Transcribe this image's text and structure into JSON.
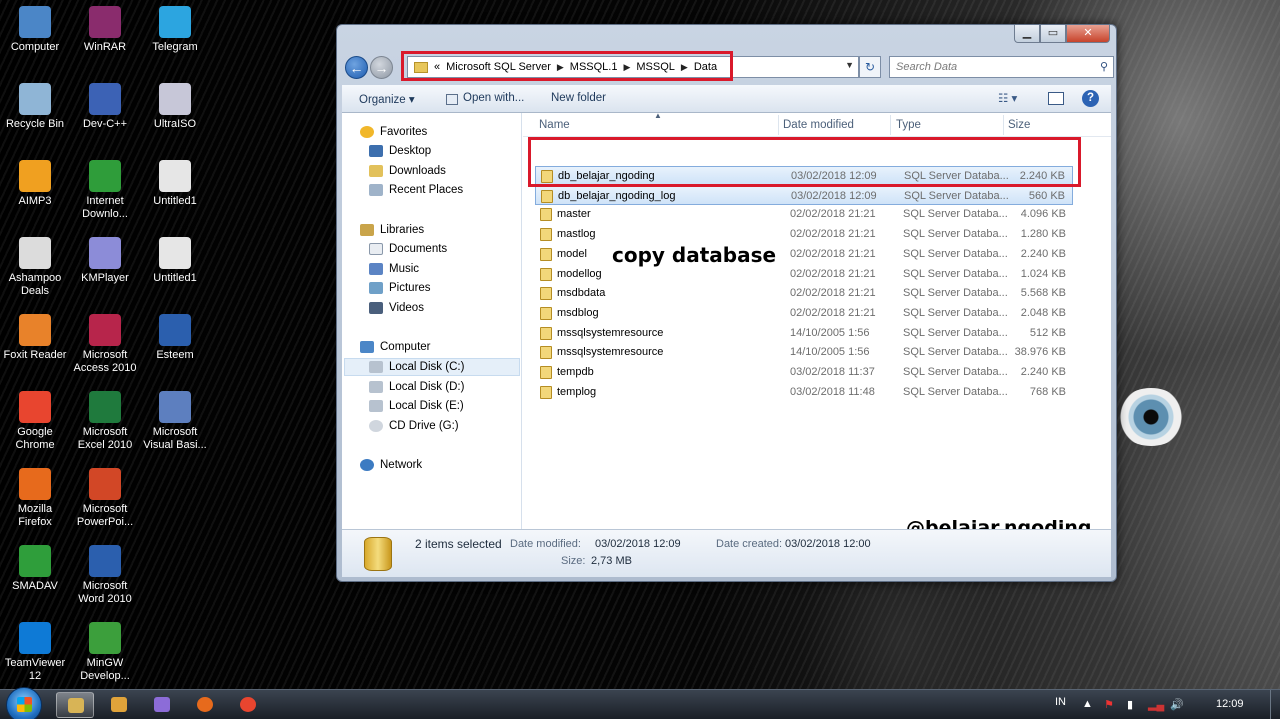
{
  "desktop_icons": [
    {
      "label": "Computer",
      "icon": "computer-icon",
      "color": "#4b86c7"
    },
    {
      "label": "WinRAR",
      "icon": "winrar-icon",
      "color": "#8a2c6d"
    },
    {
      "label": "Telegram",
      "icon": "telegram-icon",
      "color": "#2ca5e0"
    },
    {
      "label": "Recycle Bin",
      "icon": "recycle-bin-icon",
      "color": "#8fb5d6"
    },
    {
      "label": "Dev-C++",
      "icon": "devcpp-icon",
      "color": "#3c62b5"
    },
    {
      "label": "UltraISO",
      "icon": "ultraiso-icon",
      "color": "#c7c7d8"
    },
    {
      "label": "AIMP3",
      "icon": "aimp-icon",
      "color": "#f0a020"
    },
    {
      "label": "Internet Downlo...",
      "icon": "idm-icon",
      "color": "#2f9d3a"
    },
    {
      "label": "Untitled1",
      "icon": "cpp-file-icon",
      "color": "#e6e6e6"
    },
    {
      "label": "Ashampoo Deals",
      "icon": "ashampoo-icon",
      "color": "#dcdcdc"
    },
    {
      "label": "KMPlayer",
      "icon": "kmplayer-icon",
      "color": "#8c8cd8"
    },
    {
      "label": "Untitled1",
      "icon": "file-icon",
      "color": "#e6e6e6"
    },
    {
      "label": "Foxit Reader",
      "icon": "foxit-icon",
      "color": "#e8822a"
    },
    {
      "label": "Microsoft Access 2010",
      "icon": "access-icon",
      "color": "#b7254b"
    },
    {
      "label": "Esteem",
      "icon": "word-doc-icon",
      "color": "#2b5fae"
    },
    {
      "label": "Google Chrome",
      "icon": "chrome-icon",
      "color": "#e8452f"
    },
    {
      "label": "Microsoft Excel 2010",
      "icon": "excel-icon",
      "color": "#1f7a3d"
    },
    {
      "label": "Microsoft Visual Basi...",
      "icon": "visual-basic-icon",
      "color": "#5d7fbf"
    },
    {
      "label": "Mozilla Firefox",
      "icon": "firefox-icon",
      "color": "#e76a1c"
    },
    {
      "label": "Microsoft PowerPoi...",
      "icon": "powerpoint-icon",
      "color": "#d24726"
    },
    {
      "label": "",
      "icon": "blank-icon",
      "color": "transparent"
    },
    {
      "label": "SMADAV",
      "icon": "smadav-icon",
      "color": "#2f9e3b"
    },
    {
      "label": "Microsoft Word 2010",
      "icon": "word-icon",
      "color": "#2b5fae"
    },
    {
      "label": "",
      "icon": "blank-icon",
      "color": "transparent"
    },
    {
      "label": "TeamViewer 12",
      "icon": "teamviewer-icon",
      "color": "#0e7ad6"
    },
    {
      "label": "MinGW Develop...",
      "icon": "mingw-icon",
      "color": "#3c9f3c"
    }
  ],
  "window": {
    "controls": {
      "minimize": "▁",
      "maximize": "▭",
      "close": "✕"
    },
    "breadcrumb_overflow": "«",
    "breadcrumb": [
      "Microsoft SQL Server",
      "MSSQL.1",
      "MSSQL",
      "Data"
    ],
    "search_placeholder": "Search Data",
    "toolbar": {
      "organize": "Organize ▾",
      "open_with": "Open with...",
      "new_folder": "New folder"
    },
    "navigation": {
      "favorites": {
        "label": "Favorites",
        "items": [
          "Desktop",
          "Downloads",
          "Recent Places"
        ]
      },
      "libraries": {
        "label": "Libraries",
        "items": [
          "Documents",
          "Music",
          "Pictures",
          "Videos"
        ]
      },
      "computer": {
        "label": "Computer",
        "items": [
          "Local Disk (C:)",
          "Local Disk (D:)",
          "Local Disk (E:)",
          "CD Drive (G:)"
        ]
      },
      "network": {
        "label": "Network"
      }
    },
    "columns": {
      "name": "Name",
      "date": "Date modified",
      "type": "Type",
      "size": "Size"
    },
    "files": [
      {
        "name": "db_belajar_ngoding",
        "date": "03/02/2018 12:09",
        "type": "SQL Server Databa...",
        "size": "2.240 KB",
        "selected": true
      },
      {
        "name": "db_belajar_ngoding_log",
        "date": "03/02/2018 12:09",
        "type": "SQL Server Databa...",
        "size": "560 KB",
        "selected": true
      },
      {
        "name": "master",
        "date": "02/02/2018 21:21",
        "type": "SQL Server Databa...",
        "size": "4.096 KB",
        "selected": false
      },
      {
        "name": "mastlog",
        "date": "02/02/2018 21:21",
        "type": "SQL Server Databa...",
        "size": "1.280 KB",
        "selected": false
      },
      {
        "name": "model",
        "date": "02/02/2018 21:21",
        "type": "SQL Server Databa...",
        "size": "2.240 KB",
        "selected": false
      },
      {
        "name": "modellog",
        "date": "02/02/2018 21:21",
        "type": "SQL Server Databa...",
        "size": "1.024 KB",
        "selected": false
      },
      {
        "name": "msdbdata",
        "date": "02/02/2018 21:21",
        "type": "SQL Server Databa...",
        "size": "5.568 KB",
        "selected": false
      },
      {
        "name": "msdblog",
        "date": "02/02/2018 21:21",
        "type": "SQL Server Databa...",
        "size": "2.048 KB",
        "selected": false
      },
      {
        "name": "mssqlsystemresource",
        "date": "14/10/2005 1:56",
        "type": "SQL Server Databa...",
        "size": "512 KB",
        "selected": false
      },
      {
        "name": "mssqlsystemresource",
        "date": "14/10/2005 1:56",
        "type": "SQL Server Databa...",
        "size": "38.976 KB",
        "selected": false
      },
      {
        "name": "tempdb",
        "date": "03/02/2018 11:37",
        "type": "SQL Server Databa...",
        "size": "2.240 KB",
        "selected": false
      },
      {
        "name": "templog",
        "date": "03/02/2018 11:48",
        "type": "SQL Server Databa...",
        "size": "768 KB",
        "selected": false
      }
    ],
    "details": {
      "selection": "2 items selected",
      "modified_label": "Date modified:",
      "modified_value": "03/02/2018 12:09",
      "created_label": "Date created:",
      "created_value": "03/02/2018 12:00",
      "size_label": "Size:",
      "size_value": "2,73 MB"
    }
  },
  "annotations": {
    "copy_note": "copy database",
    "watermark": "@belajar.ngoding",
    "highlight_color": "#d9192b"
  },
  "taskbar": {
    "pinned": [
      {
        "icon": "explorer-icon",
        "color": "#d8b456",
        "active": true
      },
      {
        "icon": "media-player-icon",
        "color": "#e0a33a",
        "active": false
      },
      {
        "icon": "visual-studio-icon",
        "color": "#8c6cd8",
        "active": false
      },
      {
        "icon": "firefox-icon",
        "color": "#e76a1c",
        "active": false
      },
      {
        "icon": "chrome-icon",
        "color": "#e8452f",
        "active": false
      }
    ],
    "language": "IN",
    "clock": "12:09"
  }
}
